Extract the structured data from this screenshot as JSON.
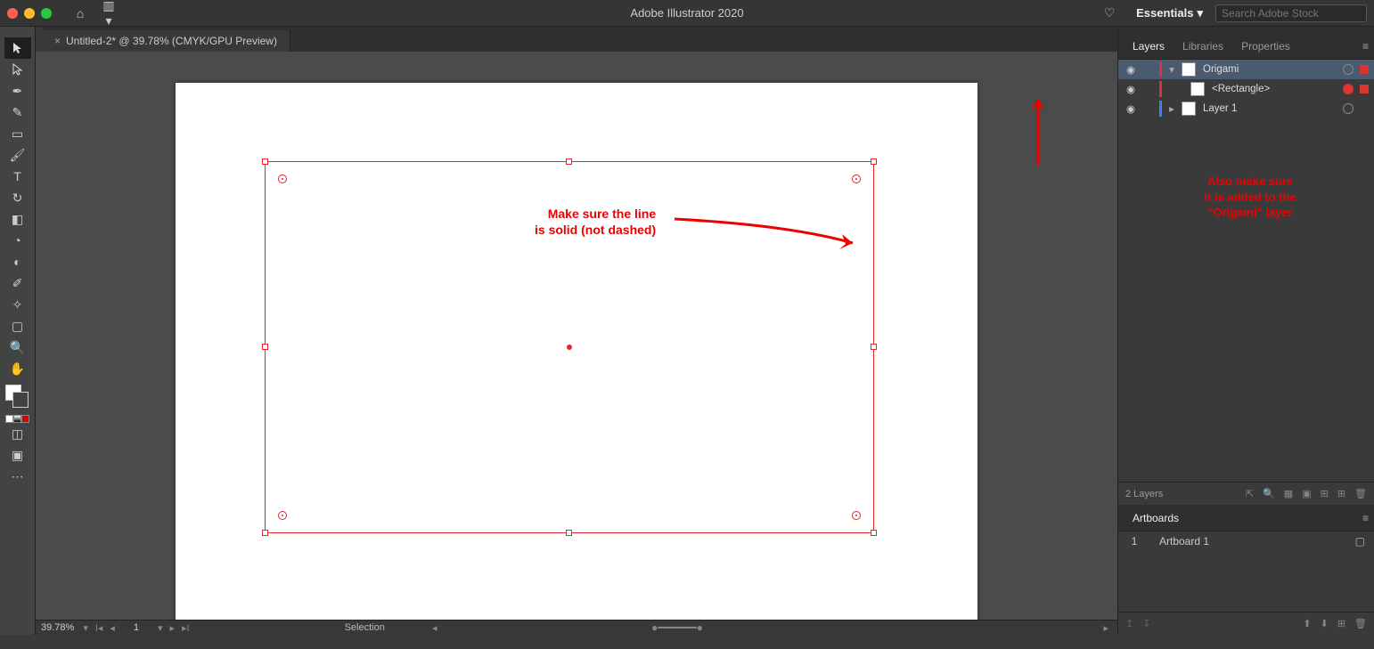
{
  "app": {
    "title": "Adobe Illustrator 2020",
    "workspace": "Essentials",
    "search_placeholder": "Search Adobe Stock"
  },
  "tab": {
    "title": "Untitled-2* @ 39.78% (CMYK/GPU Preview)"
  },
  "panels": {
    "tabs": [
      "Layers",
      "Libraries",
      "Properties"
    ],
    "active_index": 0,
    "artboards_tab": "Artboards"
  },
  "layers": {
    "items": [
      {
        "name": "Origami",
        "color": "red",
        "selected": true,
        "expanded": true,
        "targeted": false,
        "sel_indicator": true
      },
      {
        "name": "<Rectangle>",
        "color": "red",
        "selected": false,
        "expanded": false,
        "targeted": true,
        "sel_indicator": true,
        "indent": 1
      },
      {
        "name": "Layer 1",
        "color": "blue",
        "selected": false,
        "expanded": false,
        "targeted": false,
        "sel_indicator": false
      }
    ],
    "count_label": "2 Layers"
  },
  "artboards": {
    "items": [
      {
        "index": "1",
        "name": "Artboard 1"
      }
    ]
  },
  "bottom": {
    "zoom": "39.78%",
    "page": "1",
    "tool": "Selection"
  },
  "annotation": {
    "line1": "Make sure the line",
    "line2": "is solid (not dashed)",
    "panel1": "Also make sure",
    "panel2": "it is added to the",
    "panel3": "\"Origami\" layer"
  }
}
